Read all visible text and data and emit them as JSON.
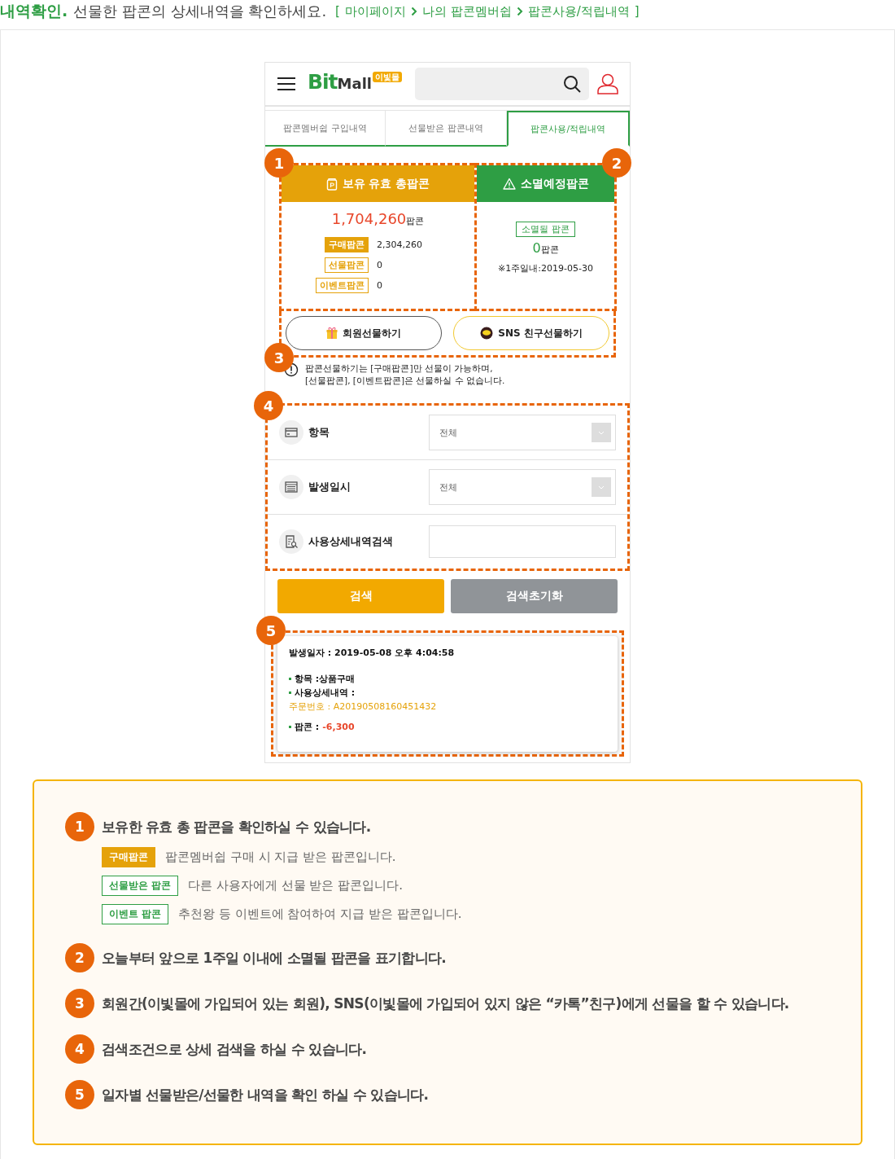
{
  "heading": {
    "title": "내역확인.",
    "subtitle": "선물한 팝콘의 상세내역을 확인하세요.",
    "bracket_open": "[",
    "breadcrumb": [
      "마이페이지",
      "나의 팝콘멤버쉽",
      "팝콘사용/적립내역"
    ],
    "bracket_close": "]"
  },
  "phone": {
    "logo": {
      "text_1": "Bit",
      "text_2": "Mall",
      "badge": "이빛몰"
    },
    "tabs": [
      {
        "label": "팝콘멤버쉽 구입내역",
        "selected": false
      },
      {
        "label": "선물받은 팝콘내역",
        "selected": false
      },
      {
        "label": "팝콘사용/적립내역",
        "selected": true
      }
    ],
    "summary": {
      "marker": "1",
      "title": "보유 유효 총팝콘",
      "amount": "1,704,260",
      "unit": "팝콘",
      "rows": [
        {
          "tag": "구매팝콘",
          "kind": "filled",
          "value": "2,304,260"
        },
        {
          "tag": "선물팝콘",
          "kind": "outline",
          "value": "0"
        },
        {
          "tag": "이벤트팝콘",
          "kind": "outline",
          "value": "0"
        }
      ]
    },
    "expiring": {
      "marker": "2",
      "title": "소멸예정팝콘",
      "tag": "소멸될 팝콘",
      "amount": "0",
      "unit": "팝콘",
      "note": "※1주일내:2019-05-30"
    },
    "gift": {
      "marker": "3",
      "buttons": [
        {
          "label": "회원선물하기",
          "kind": "member"
        },
        {
          "label": "SNS 친구선물하기",
          "kind": "sns"
        }
      ],
      "notice": "팝콘선물하기는 [구매팝콘]만 선물이 가능하며,\n[선물팝콘], [이벤트팝콘]은 선물하실 수 없습니다."
    },
    "filters": {
      "marker": "4",
      "rows": [
        {
          "label": "항목",
          "kind": "select",
          "value": "전체"
        },
        {
          "label": "발생일시",
          "kind": "select",
          "value": "전체"
        },
        {
          "label": "사용상세내역검색",
          "kind": "input"
        }
      ]
    },
    "actions": [
      {
        "label": "검색",
        "kind": "primary"
      },
      {
        "label": "검색초기화",
        "kind": "secondary"
      }
    ],
    "result": {
      "marker": "5",
      "date": "발생일자 : 2019-05-08 오후 4:04:58",
      "item": "항목 :상품구매",
      "detail": "사용상세내역 :",
      "order": "주문번호 : A20190508160451432",
      "popcon_label": "팝콘 :",
      "popcon_value": "-6,300"
    }
  },
  "guide": {
    "items": [
      {
        "number": "1",
        "text": "보유한 유효 총 팝콘을 확인하실 수 있습니다.",
        "rows": [
          {
            "tag": "구매팝콘",
            "kind": "filled",
            "text": "팝콘멤버쉽 구매 시 지급 받은 팝콘입니다."
          },
          {
            "tag": "선물받은 팝콘",
            "kind": "outline",
            "text": "다른 사용자에게 선물 받은 팝콘입니다."
          },
          {
            "tag": "이벤트 팝콘",
            "kind": "outline",
            "text": "추천왕 등 이벤트에 참여하여 지급 받은 팝콘입니다."
          }
        ]
      },
      {
        "number": "2",
        "text": "오늘부터 앞으로 1주일 이내에 소멸될 팝콘을 표기합니다."
      },
      {
        "number": "3",
        "text": "회원간(이빛몰에 가입되어 있는 회원), SNS(이빛몰에 가입되어 있지 않은 “카톡”친구)에게 선물을 할 수 있습니다."
      },
      {
        "number": "4",
        "text": "검색조건으로 상세 검색을 하실 수 있습니다."
      },
      {
        "number": "5",
        "text": "일자별 선물받은/선물한 내역을 확인 하실 수 있습니다."
      }
    ]
  }
}
